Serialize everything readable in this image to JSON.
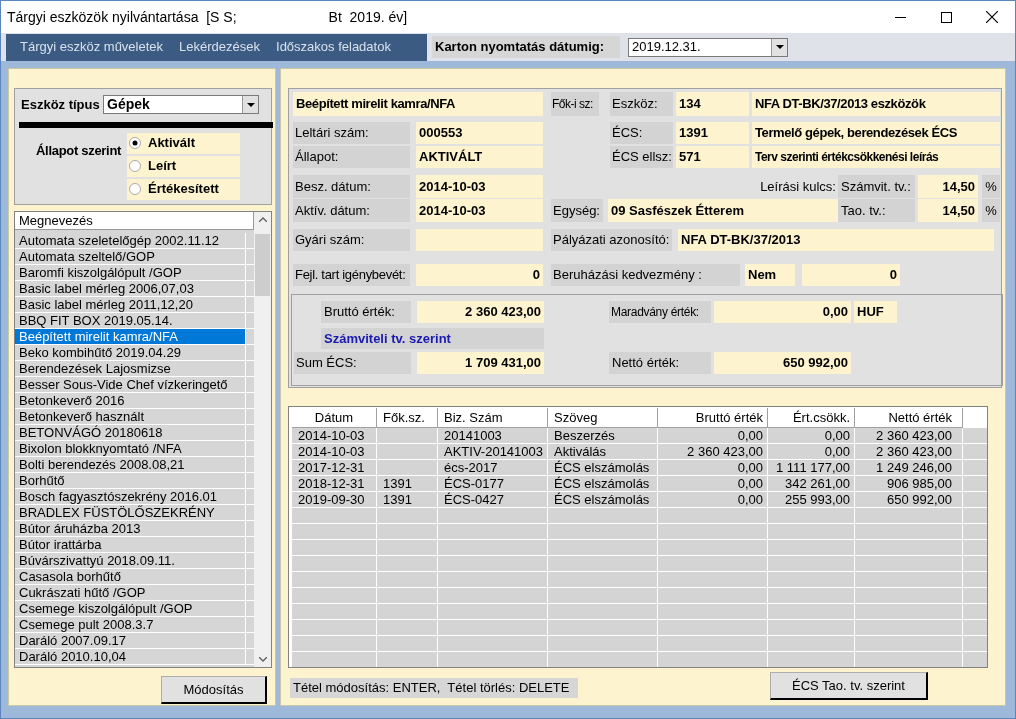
{
  "window": {
    "title": "Tárgyi eszközök nyilvántartása  [S S;",
    "title_suffix": "Bt  2019. év]"
  },
  "menu": [
    "Tárgyi eszköz műveletek",
    "Lekérdezések",
    "Időszakos feladatok"
  ],
  "print_date": {
    "label": "Karton nyomtatás dátumig:",
    "value": "2019.12.31."
  },
  "filter": {
    "type_label": "Eszköz típus",
    "type_value": "Gépek",
    "status_label": "Állapot szerint",
    "options": [
      {
        "label": "Aktivált",
        "selected": true
      },
      {
        "label": "Leírt",
        "selected": false
      },
      {
        "label": "Értékesített",
        "selected": false
      }
    ]
  },
  "asset_list": {
    "column": "Megnevezés",
    "items": [
      {
        "name": "Automata szeletelőgép 2002.11.12",
        "selected": false
      },
      {
        "name": "Automata szeltelő/GOP",
        "selected": false
      },
      {
        "name": "Baromfi kiszolgálópult /GOP",
        "selected": false
      },
      {
        "name": "Basic label mérleg 2006,07,03",
        "selected": false
      },
      {
        "name": "Basic label mérleg 2011,12,20",
        "selected": false
      },
      {
        "name": "BBQ FIT BOX 2019.05.14.",
        "selected": false
      },
      {
        "name": "Beépített mirelit kamra/NFA",
        "selected": true
      },
      {
        "name": "Beko kombihűtő 2019.04.29",
        "selected": false
      },
      {
        "name": "Berendezések Lajosmizse",
        "selected": false
      },
      {
        "name": "Besser Sous-Vide Chef vízkeringető",
        "selected": false
      },
      {
        "name": "Betonkeverő 2016",
        "selected": false
      },
      {
        "name": "Betonkeverő használt",
        "selected": false
      },
      {
        "name": "BETONVÁGÓ 20180618",
        "selected": false
      },
      {
        "name": "Bixolon blokknyomtató /NFA",
        "selected": false
      },
      {
        "name": "Bolti berendezés 2008.08,21",
        "selected": false
      },
      {
        "name": "Borhűtő",
        "selected": false
      },
      {
        "name": "Bosch fagyasztószekrény 2016.01",
        "selected": false
      },
      {
        "name": "BRADLEX FÜSTÖLŐSZEKRÉNY",
        "selected": false
      },
      {
        "name": "Bútor áruházba 2013",
        "selected": false
      },
      {
        "name": "Bútor irattárba",
        "selected": false
      },
      {
        "name": "Búvárszivattyú 2018.09.11.",
        "selected": false
      },
      {
        "name": "Casasola borhűtő",
        "selected": false
      },
      {
        "name": "Cukrászati hűtő /GOP",
        "selected": false
      },
      {
        "name": "Csemege kiszolgálópult /GOP",
        "selected": false
      },
      {
        "name": "Csemege pult 2008.3.7",
        "selected": false
      },
      {
        "name": "Daráló 2007.09.17",
        "selected": false
      },
      {
        "name": "Daráló 2010.10,04",
        "selected": false
      }
    ]
  },
  "modify_button": "Módosítás",
  "details": {
    "name": "Beépített mirelit kamra/NFA",
    "main_account_label": "Fők-i sz:",
    "asset_account": {
      "label": "Eszköz:",
      "code": "134",
      "name": "NFA DT-BK/37/2013 eszközök"
    },
    "inventory_no": {
      "label": "Leltári szám:",
      "value": "000553"
    },
    "ecs_account": {
      "label": "ÉCS:",
      "code": "1391",
      "name": "Termelő gépek, berendezések ÉCS"
    },
    "status": {
      "label": "Állapot:",
      "value": "AKTIVÁLT"
    },
    "ecs_contra": {
      "label": "ÉCS ellsz:",
      "code": "571",
      "name": "Terv szerinti értékcsökkenési leírás"
    },
    "purchase_date": {
      "label": "Besz. dátum:",
      "value": "2014-10-03"
    },
    "depreciation_key_label": "Leírási kulcs:",
    "accounting_rate": {
      "label": "Számvit. tv.:",
      "value": "14,50",
      "unit": "%"
    },
    "activation_date": {
      "label": "Aktív. dátum:",
      "value": "2014-10-03"
    },
    "unit": {
      "label": "Egység:",
      "value": "09 Sasfészek Étterem"
    },
    "tax_rate": {
      "label": "Tao. tv.:",
      "value": "14,50",
      "unit": "%"
    },
    "serial_no": {
      "label": "Gyári szám:"
    },
    "grant_id": {
      "label": "Pályázati azonosító:",
      "value": "NFA DT-BK/37/2013"
    },
    "dev_reserve": {
      "label": "Fejl. tart igénybevét:",
      "value": "0"
    },
    "investment_allowance": {
      "label": "Beruházási kedvezmény :",
      "flag": "Nem",
      "value": "0"
    },
    "gross": {
      "label": "Bruttó érték:",
      "value": "2 360 423,00"
    },
    "residual": {
      "label": "Maradvány érték:",
      "value": "0,00",
      "currency": "HUF"
    },
    "section_title": "Számviteli tv. szerint",
    "sum_depreciation": {
      "label": "Sum ÉCS:",
      "value": "1 709 431,00"
    },
    "net": {
      "label": "Nettó érték:",
      "value": "650 992,00"
    }
  },
  "transactions": {
    "columns": [
      "Dátum",
      "Fők.sz.",
      "Biz. Szám",
      "Szöveg",
      "Bruttó érték",
      "Ért.csökk.",
      "Nettó érték"
    ],
    "rows": [
      [
        "2014-10-03",
        "",
        "20141003",
        "Beszerzés",
        "0,00",
        "0,00",
        "2 360 423,00"
      ],
      [
        "2014-10-03",
        "",
        "AKTIV-20141003",
        "Aktiválás",
        "2 360 423,00",
        "0,00",
        "2 360 423,00"
      ],
      [
        "2017-12-31",
        "",
        "écs-2017",
        "ÉCS elszámolás",
        "0,00",
        "1 111 177,00",
        "1 249 246,00"
      ],
      [
        "2018-12-31",
        "1391",
        "ÉCS-0177",
        "ÉCS elszámolás",
        "0,00",
        "342 261,00",
        "906 985,00"
      ],
      [
        "2019-09-30",
        "1391",
        "ÉCS-0427",
        "ÉCS elszámolás",
        "0,00",
        "255 993,00",
        "650 992,00"
      ]
    ]
  },
  "hint": "Tétel módosítás: ENTER,  Tétel törlés: DELETE",
  "tax_button": "ÉCS Tao. tv. szerint"
}
